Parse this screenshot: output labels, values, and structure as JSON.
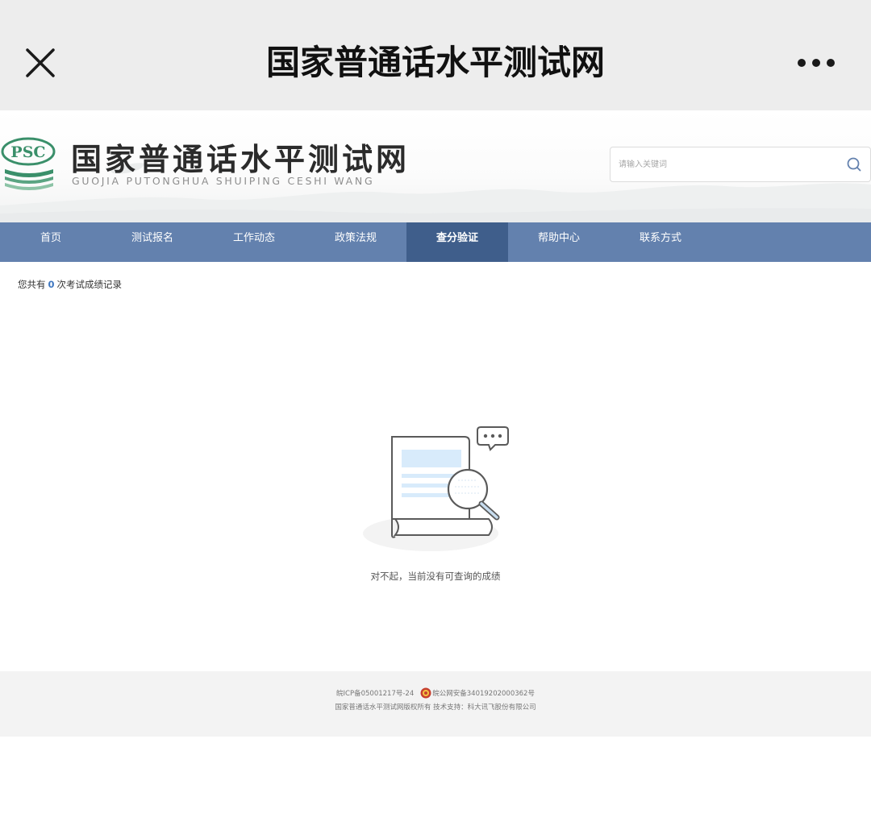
{
  "appbar": {
    "title": "国家普通话水平测试网"
  },
  "header": {
    "logo_badge": "PSC",
    "logo_cn": "国家普通话水平测试网",
    "logo_en": "GUOJIA PUTONGHUA SHUIPING CESHI WANG",
    "search_placeholder": "请输入关键词"
  },
  "nav": {
    "items": [
      {
        "label": "首页"
      },
      {
        "label": "测试报名"
      },
      {
        "label": "工作动态"
      },
      {
        "label": "政策法规"
      },
      {
        "label": "查分验证",
        "active": true
      },
      {
        "label": "帮助中心"
      },
      {
        "label": "联系方式"
      }
    ]
  },
  "content": {
    "summary_prefix": "您共有",
    "record_count": "0",
    "summary_suffix": "次考试成绩记录",
    "empty_message": "对不起，当前没有可查询的成绩"
  },
  "footer": {
    "icp": "皖ICP备05001217号-24",
    "police_record": "皖公网安备34019202000362号",
    "copyright": "国家普通话水平测试网版权所有 技术支持：科大讯飞股份有限公司"
  },
  "colors": {
    "nav_bg": "#6381ae",
    "nav_active": "#3f5e8b",
    "logo_green": "#3a8f6a",
    "count_blue": "#3f77c0"
  }
}
